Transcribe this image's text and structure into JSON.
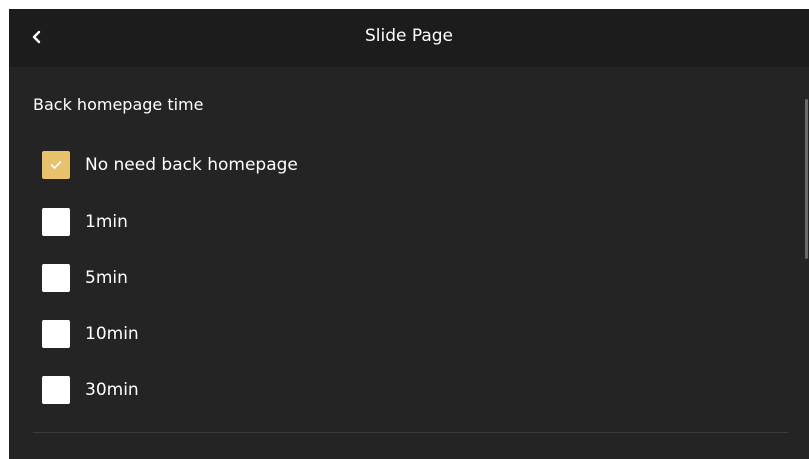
{
  "header": {
    "title": "Slide Page",
    "back_icon": "chevron-left-icon"
  },
  "section": {
    "label": "Back homepage time"
  },
  "options": [
    {
      "label": "No need back homepage",
      "checked": true
    },
    {
      "label": "1min",
      "checked": false
    },
    {
      "label": "5min",
      "checked": false
    },
    {
      "label": "10min",
      "checked": false
    },
    {
      "label": "30min",
      "checked": false
    }
  ],
  "colors": {
    "background": "#242424",
    "header": "#1c1c1c",
    "accent": "#e8c26c",
    "text": "#ffffff"
  }
}
